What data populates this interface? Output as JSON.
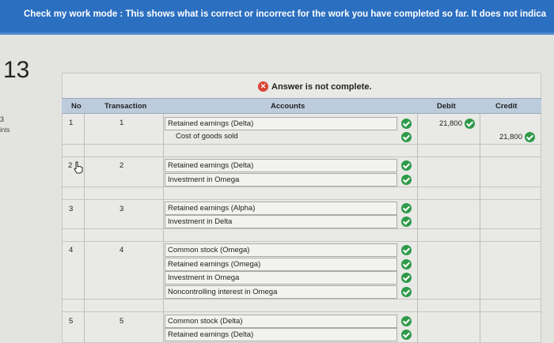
{
  "banner": {
    "text": "Check my work mode : This shows what is correct or incorrect for the work you have completed so far. It does not indica"
  },
  "question": {
    "number": "13",
    "points_value": "3",
    "points_label": "ints"
  },
  "status": {
    "text": "Answer is not complete.",
    "color": "#d84335"
  },
  "table": {
    "headers": {
      "no": "No",
      "transaction": "Transaction",
      "accounts": "Accounts",
      "debit": "Debit",
      "credit": "Credit"
    },
    "rows": [
      {
        "no": "1",
        "transaction": "1",
        "accounts": [
          "Retained earnings (Delta)",
          "Cost of goods sold"
        ],
        "debit": "21,800",
        "credit": "21,800"
      },
      {
        "no": "2",
        "transaction": "2",
        "accounts": [
          "Retained earnings (Delta)",
          "Investment in Omega"
        ]
      },
      {
        "no": "3",
        "transaction": "3",
        "accounts": [
          "Retained earnings (Alpha)",
          "Investment in Delta"
        ]
      },
      {
        "no": "4",
        "transaction": "4",
        "accounts": [
          "Common stock (Omega)",
          "Retained earnings (Omega)",
          "Investment in Omega",
          "Noncontrolling interest in Omega"
        ]
      },
      {
        "no": "5",
        "transaction": "5",
        "accounts": [
          "Common stock (Delta)",
          "Retained earnings (Delta)"
        ]
      }
    ]
  },
  "colors": {
    "banner": "#2b6fc0",
    "header_row": "#bcccdc",
    "check": "#2e9a49"
  },
  "icons": {
    "status": "error-x-icon",
    "check": "check-circle-icon",
    "pointer": "hand-pointer-icon"
  }
}
